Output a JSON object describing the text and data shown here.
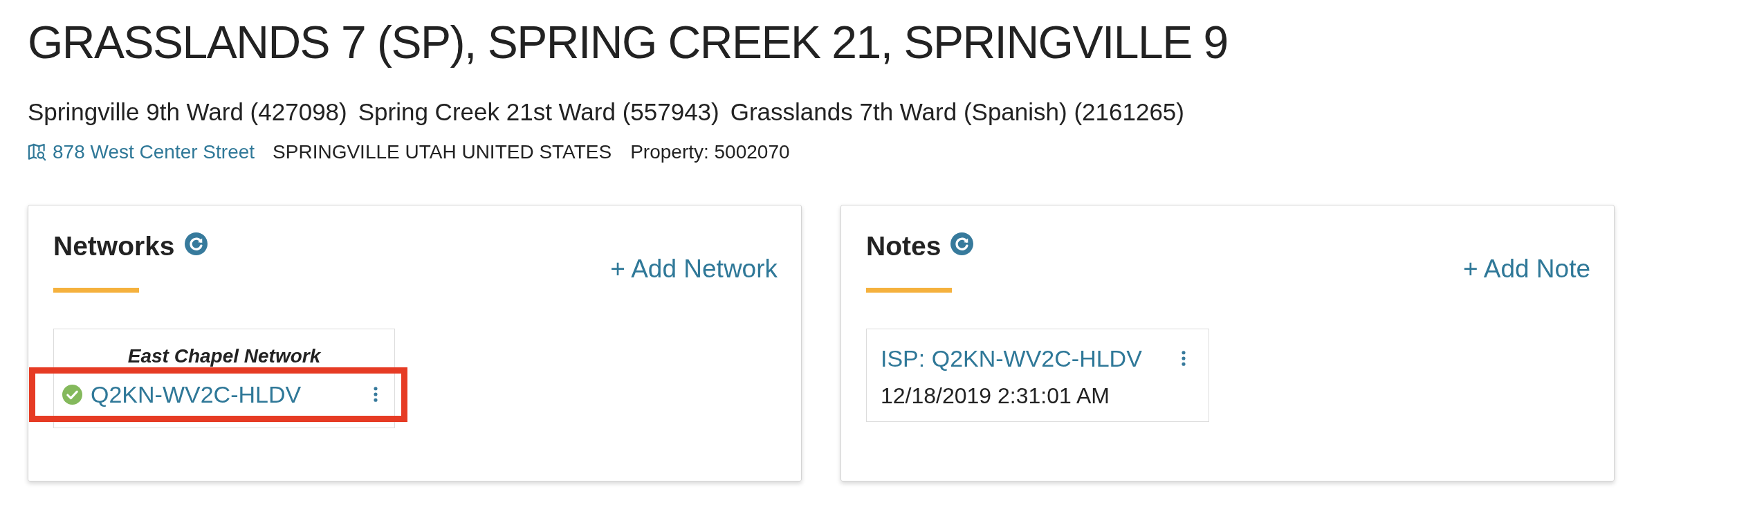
{
  "title": "GRASSLANDS 7 (SP), SPRING CREEK 21, SPRINGVILLE 9",
  "wards": [
    "Springville 9th Ward (427098)",
    "Spring Creek 21st Ward (557943)",
    "Grasslands 7th Ward (Spanish) (2161265)"
  ],
  "address": {
    "street": "878 West Center Street",
    "locality": "SPRINGVILLE UTAH UNITED STATES",
    "property": "Property: 5002070"
  },
  "networks_panel": {
    "heading": "Networks",
    "add_action": "+ Add Network",
    "networks": [
      {
        "name": "East Chapel Network",
        "devices": [
          {
            "code": "Q2KN-WV2C-HLDV",
            "online": true,
            "highlighted": true
          }
        ]
      }
    ]
  },
  "notes_panel": {
    "heading": "Notes",
    "add_action": "+ Add Note",
    "notes": [
      {
        "title": "ISP: Q2KN-WV2C-HLDV",
        "timestamp": "12/18/2019 2:31:01 AM"
      }
    ]
  }
}
